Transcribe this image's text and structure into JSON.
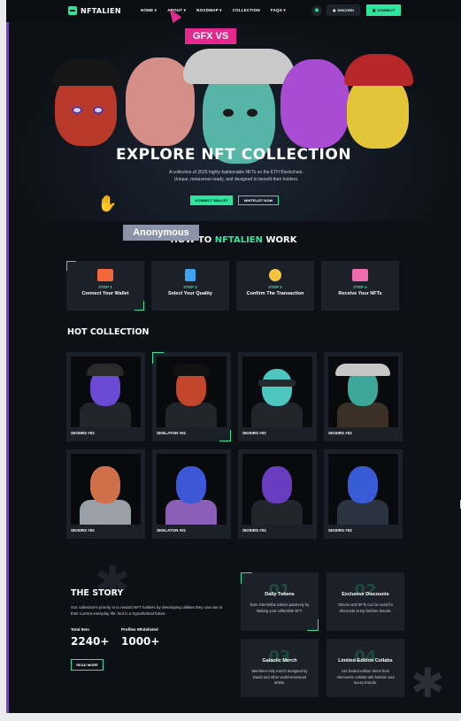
{
  "header": {
    "logo": "NFTALIEN",
    "nav": [
      "HOME ▾",
      "ABOUT ▾",
      "ROADMAP ▾",
      "COLLECTION",
      "FAQS ▾"
    ],
    "discord_label": "DISCORD",
    "connect_label": "CONNECT"
  },
  "overlays": {
    "gfx_badge": "GFX VS",
    "anon_badge": "Anonymous"
  },
  "hero": {
    "title": "EXPLORE NFT COLLECTION",
    "subtitle": "A collection of 2525 highly-fashionable NFTs on the ETH Blockchain. Unique, metaverse-ready, and designed to benefit their holders.",
    "btn_connect": "CONNECT WALLET",
    "btn_whitelist": "WHITELIST NOW"
  },
  "howto": {
    "title_pre": "HOW TO ",
    "title_brand": "NFTALIEN",
    "title_post": " WORK",
    "steps": [
      {
        "num": "STEP 1",
        "title": "Connect Your Wallet",
        "color": "#f2683c"
      },
      {
        "num": "STEP 2",
        "title": "Select Your Quality",
        "color": "#3ea2f0"
      },
      {
        "num": "STEP 3",
        "title": "Confirm The Transaction",
        "color": "#f5c542"
      },
      {
        "num": "STEP 4",
        "title": "Receive Your NFTs",
        "color": "#f06bb0"
      }
    ]
  },
  "collection": {
    "title": "HOT COLLECTION",
    "items": [
      {
        "name": "SKISIRS #02",
        "skin": "#6b4bd6",
        "cap": "#2a2a2a"
      },
      {
        "name": "SKELATON #01",
        "skin": "#c2452c",
        "cap": "#111111"
      },
      {
        "name": "SKISIRS #02",
        "skin": "#4ec6c0",
        "cap": "#222a30"
      },
      {
        "name": "SKISIRS #02",
        "skin": "#3da89a",
        "cap": "#c7c7c7"
      },
      {
        "name": "SKISIRS #02",
        "skin": "#d0704a",
        "cap": ""
      },
      {
        "name": "SKELATON #01",
        "skin": "#3c57d8",
        "cap": ""
      },
      {
        "name": "SKISIRS #02",
        "skin": "#6a3cbf",
        "cap": ""
      },
      {
        "name": "SKISIRS #02",
        "skin": "#3a5bd6",
        "cap": ""
      }
    ]
  },
  "story": {
    "title": "THE STORY",
    "text": "Our collection's priority is to reward NFT holders by developing utilities they can use in their current everyday life. Not in a hypothetical future.",
    "stats": [
      {
        "label": "Total Item",
        "value": "2240+"
      },
      {
        "label": "Profiles Whitelisted",
        "value": "1000+"
      }
    ],
    "read_more": "READ MORE",
    "features": [
      {
        "num": "01",
        "title": "Daily Tokens",
        "desc": "Earn interstellar tokens passively by staking your collectible NFT."
      },
      {
        "num": "02",
        "title": "Exclusive Discounts",
        "desc": "Tokens and NFTs can be used for discounts at top fashion brands."
      },
      {
        "num": "03",
        "title": "Galactic Merch",
        "desc": "Members-only merch designed by David and other world-renowned artists."
      },
      {
        "num": "04",
        "title": "Limited-Edition Collabs",
        "desc": "Get limited-edition items from Alienverse collabs with fashion and luxury brands."
      }
    ]
  },
  "colors": {
    "accent": "#2ee59d",
    "card": "#1b2029",
    "bg": "#0d1117",
    "pink": "#e3298d"
  }
}
